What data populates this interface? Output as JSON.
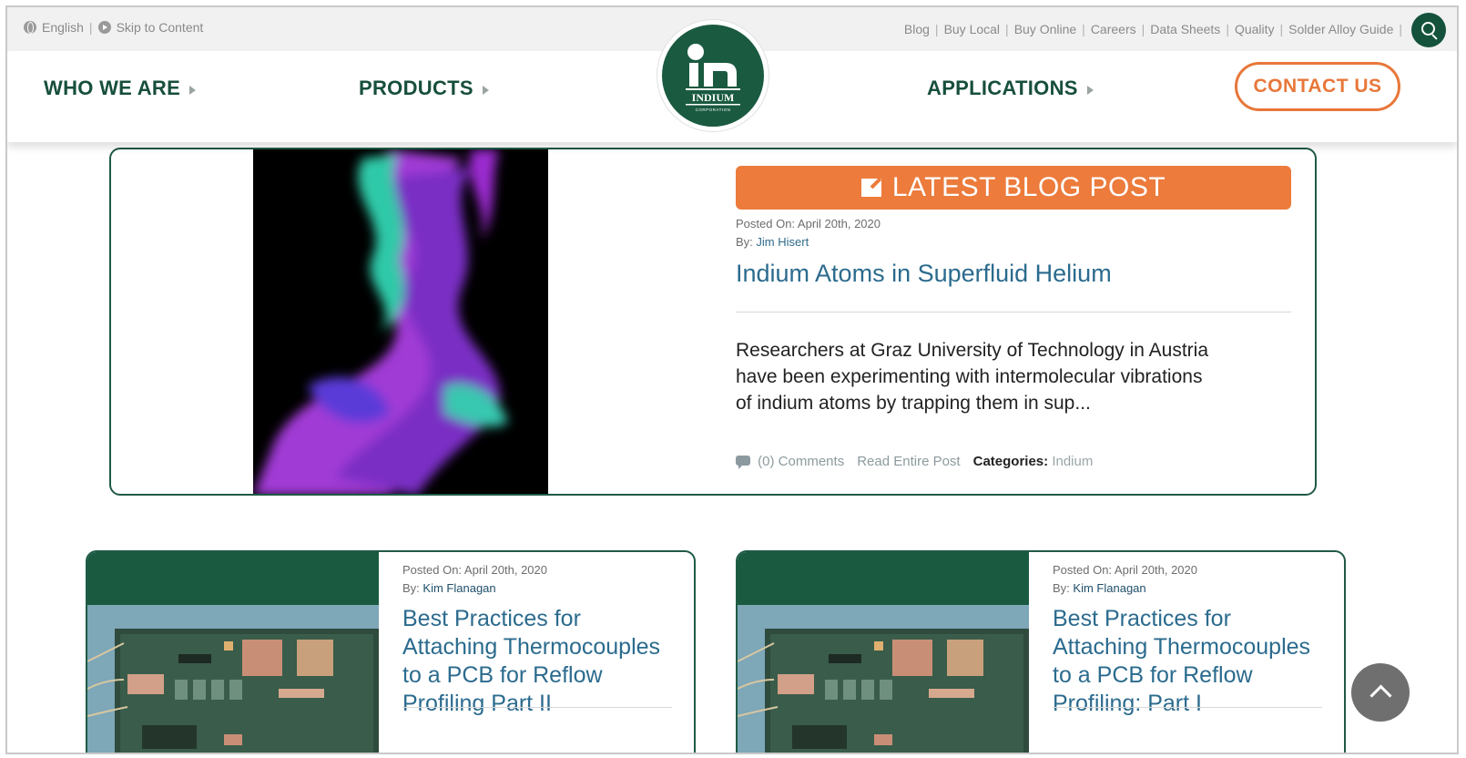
{
  "utility_bar": {
    "language": "English",
    "skip": "Skip to Content",
    "links": [
      "Blog",
      "Buy Local",
      "Buy Online",
      "Careers",
      "Data Sheets",
      "Quality",
      "Solder Alloy Guide"
    ]
  },
  "nav": {
    "who_we_are": "WHO WE ARE",
    "products": "PRODUCTS",
    "applications": "APPLICATIONS",
    "contact": "CONTACT US",
    "logo_text": "INDIUM",
    "logo_subtext": "CORPORATION"
  },
  "featured": {
    "badge": "LATEST BLOG POST",
    "posted": "Posted On: April 20th, 2020",
    "by_label": "By:",
    "author": "Jim Hisert",
    "title": "Indium Atoms in Superfluid Helium",
    "excerpt": "Researchers at Graz University of Technology in Austria have been experimenting with intermolecular vibrations of indium atoms by trapping them in sup...",
    "comments": "(0) Comments",
    "read_more": "Read Entire Post",
    "categories_label": "Categories:",
    "category": "Indium"
  },
  "cards": [
    {
      "posted": "Posted On: April 20th, 2020",
      "by_label": "By:",
      "author": "Kim Flanagan",
      "title": "Best Practices for Attaching Thermocouples to a PCB for Reflow Profiling Part II"
    },
    {
      "posted": "Posted On: April 20th, 2020",
      "by_label": "By:",
      "author": "Kim Flanagan",
      "title": "Best Practices for Attaching Thermocouples to a PCB for Reflow Profiling: Part I"
    }
  ],
  "colors": {
    "brand_green": "#1a5a40",
    "accent_orange": "#ec7b3c",
    "link_blue": "#2b6b8e"
  },
  "icons": {
    "language": "globe-icon",
    "skip": "skip-arrow-icon",
    "search": "search-icon",
    "badge": "edit-icon",
    "comments": "comment-icon",
    "back_to_top": "chevron-up-icon"
  }
}
